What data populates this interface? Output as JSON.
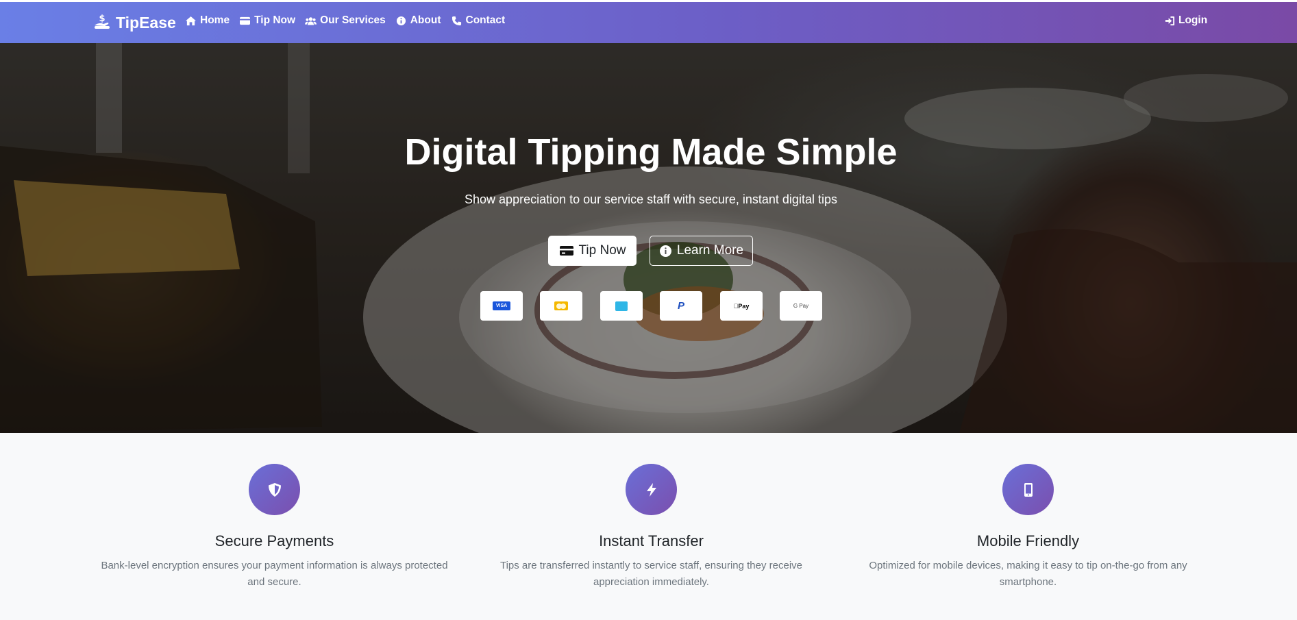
{
  "brand": {
    "name": "TipEase",
    "icon": "hand-holding-dollar-icon"
  },
  "nav": {
    "links": [
      {
        "label": "Home",
        "icon": "home-icon"
      },
      {
        "label": "Tip Now",
        "icon": "credit-card-icon"
      },
      {
        "label": "Our Services",
        "icon": "users-icon"
      },
      {
        "label": "About",
        "icon": "info-circle-icon"
      },
      {
        "label": "Contact",
        "icon": "phone-icon"
      }
    ],
    "login_label": "Login"
  },
  "hero": {
    "title": "Digital Tipping Made Simple",
    "subtitle": "Show appreciation to our service staff with secure, instant digital tips",
    "primary_button": "Tip Now",
    "secondary_button": "Learn More",
    "payment_methods": [
      {
        "name": "Visa",
        "label": "VISA"
      },
      {
        "name": "Mastercard",
        "label": ""
      },
      {
        "name": "American Express",
        "label": ""
      },
      {
        "name": "PayPal",
        "label": "P"
      },
      {
        "name": "Apple Pay",
        "label": "Pay"
      },
      {
        "name": "Google Pay",
        "label": "G Pay"
      }
    ]
  },
  "features": [
    {
      "title": "Secure Payments",
      "text": "Bank-level encryption ensures your payment information is always protected and secure.",
      "icon": "shield-icon"
    },
    {
      "title": "Instant Transfer",
      "text": "Tips are transferred instantly to service staff, ensuring they receive appreciation immediately.",
      "icon": "bolt-icon"
    },
    {
      "title": "Mobile Friendly",
      "text": "Optimized for mobile devices, making it easy to tip on-the-go from any smartphone.",
      "icon": "mobile-icon"
    }
  ],
  "colors": {
    "nav_gradient_start": "#6a7fe6",
    "nav_gradient_end": "#7a4aa6",
    "feature_icon": "#6a6fd7"
  }
}
